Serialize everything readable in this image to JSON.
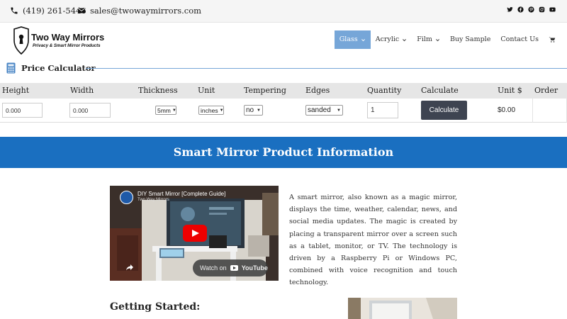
{
  "topbar": {
    "phone": "(419) 261-5446",
    "email": "sales@twowaymirrors.com",
    "social_icons": [
      "twitter-icon",
      "facebook-icon",
      "pinterest-icon",
      "instagram-icon",
      "youtube-icon"
    ]
  },
  "header": {
    "brand": "Two Way Mirrors",
    "tagline": "Privacy & Smart Mirror Products",
    "nav": [
      {
        "label": "Glass",
        "active": true,
        "dropdown": true
      },
      {
        "label": "Acrylic",
        "active": false,
        "dropdown": true
      },
      {
        "label": "Film",
        "active": false,
        "dropdown": true
      },
      {
        "label": "Buy Sample",
        "active": false,
        "dropdown": false
      },
      {
        "label": "Contact Us",
        "active": false,
        "dropdown": false
      }
    ],
    "accent_color": "#76a6d8"
  },
  "calculator": {
    "title": "Price Calculator",
    "headers": [
      "Height",
      "Width",
      "Thickness",
      "Unit",
      "Tempering",
      "Edges",
      "Quantity",
      "Calculate",
      "Unit $",
      "Order"
    ],
    "height_placeholder": "0.000",
    "width_placeholder": "0.000",
    "thickness_selected": "5mm",
    "unit_selected": "inches",
    "tempering_selected": "no",
    "edges_selected": "sanded",
    "quantity_value": "1",
    "calculate_label": "Calculate",
    "unit_price": "$0.00"
  },
  "banner": {
    "title": "Smart Mirror Product Information",
    "color": "#1a6fc0"
  },
  "video": {
    "title": "DIY Smart Mirror [Complete Guide]",
    "channel": "Two Way Mirrors",
    "watch_label": "Watch on",
    "platform_label": "YouTube"
  },
  "description": "A smart mirror, also known as a magic mirror, displays the time, weather, calendar, news, and social media updates. The magic is created by placing a transparent mirror over a screen such as a tablet, monitor, or TV. The technology is driven by a Raspberry Pi or Windows PC, combined with voice recognition and touch technology.",
  "getting_started": {
    "heading": "Getting Started:"
  }
}
